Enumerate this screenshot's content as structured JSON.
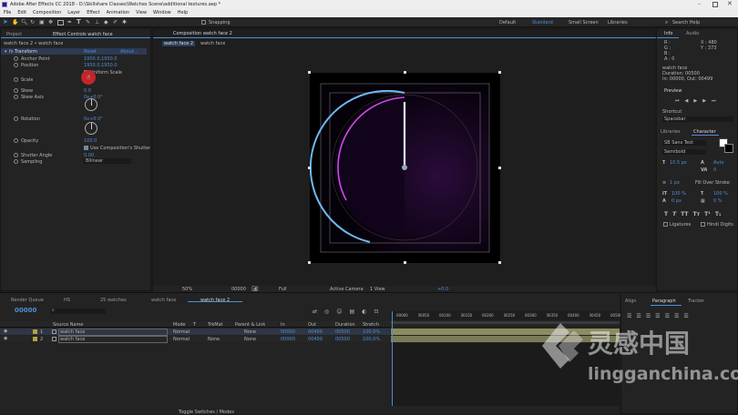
{
  "window": {
    "title": "Adobe After Effects CC 2018 - D:\\Skillshare Classes\\Watches Scene\\additional textures.aep *"
  },
  "menu": [
    "File",
    "Edit",
    "Composition",
    "Layer",
    "Effect",
    "Animation",
    "View",
    "Window",
    "Help"
  ],
  "toolbar": {
    "snapping": "Snapping",
    "workspaces": [
      "Default",
      "Standard",
      "Small Screen",
      "Libraries"
    ],
    "search_placeholder": "Search Help"
  },
  "left_panel": {
    "tab_project": "Project",
    "tab_effects": "Effect Controls watch face",
    "subtitle": "watch face 2 • watch face",
    "transform": "Transform",
    "reset": "Reset",
    "about": "About...",
    "props": [
      {
        "label": "Anchor Point",
        "value": "1950.0,1950.0"
      },
      {
        "label": "Position",
        "value": "1950.0,1950.0"
      },
      {
        "label": "",
        "value": "Uniform Scale"
      },
      {
        "label": "Scale",
        "value": "40.0"
      },
      {
        "label": "Skew",
        "value": "0.0"
      },
      {
        "label": "Skew Axis",
        "value": "0x+0.0°"
      },
      {
        "label": "Rotation",
        "value": "0x+0.0°"
      },
      {
        "label": "Opacity",
        "value": "100.0"
      },
      {
        "label": "",
        "value": "Use Composition's Shutter"
      },
      {
        "label": "Shutter Angle",
        "value": "0.00"
      },
      {
        "label": "Sampling",
        "value": "Bilinear"
      }
    ]
  },
  "comp": {
    "tab": "Composition watch face 2",
    "subtab1": "watch face 2",
    "subtab2": "watch face",
    "footer": {
      "zoom": "50%",
      "time": "00000",
      "quality": "Full",
      "camera": "Active Camera",
      "view": "1 View",
      "exposure": "+0.0"
    }
  },
  "right_panel": {
    "info_tab": "Info",
    "audio_tab": "Audio",
    "info_lines": [
      "R : ",
      "G : ",
      "B : ",
      "A : 0"
    ],
    "xy": [
      "X : 480",
      "Y : 373"
    ],
    "info_name": "watch face",
    "info_duration": "Duration: 00500",
    "info_in_out": "In: 00000, Out: 00499",
    "preview_tab": "Preview",
    "shortcut_label": "Shortcut",
    "shortcut_value": "Spacebar",
    "libraries_tab": "Libraries",
    "character_tab": "Character",
    "font": "SB Sans Text",
    "font_style": "Semibold",
    "size": "10.5 px",
    "leading": "Auto",
    "tracking": "0",
    "stroke_size": "1 px",
    "stroke_mode": "Fill Over Stroke",
    "vscale": "100 %",
    "hscale": "100 %",
    "baseline": "0 px",
    "tsume": "0 %",
    "ligatures": "Ligatures",
    "hindi": "Hindi Digits"
  },
  "timeline": {
    "tabs": [
      "Render Queue",
      "HS",
      "25 watches",
      "watch face",
      "watch face 2"
    ],
    "timecode": "00000",
    "search_placeholder": "",
    "columns": [
      "Source Name",
      "Mode",
      "T",
      "TrkMat",
      "Parent & Link",
      "In",
      "Out",
      "Duration",
      "Stretch"
    ],
    "layers": [
      {
        "num": "1",
        "name": "watch face",
        "mode": "Normal",
        "trkmat": "",
        "parent": "None",
        "in": "00000",
        "out": "00499",
        "dur": "00500",
        "stretch": "100.0%"
      },
      {
        "num": "2",
        "name": "watch face",
        "mode": "Normal",
        "trkmat": "None",
        "parent": "None",
        "in": "00000",
        "out": "00499",
        "dur": "00500",
        "stretch": "100.0%"
      }
    ],
    "ruler": [
      "00000",
      "00050",
      "00100",
      "00150",
      "00200",
      "00250",
      "00300",
      "00350",
      "00400",
      "00450",
      "00500"
    ],
    "toggle": "Toggle Switches / Modes"
  },
  "bottom_right": {
    "tabs": [
      "Align",
      "Paragraph",
      "Tracker"
    ]
  },
  "watermark": {
    "name": "灵感中国",
    "url": "lingganchina.com"
  },
  "colors": {
    "accent": "#2d8ceb",
    "bg": "#232323",
    "watch_magenta": "#c040e0",
    "watch_blue": "#70b8f0"
  }
}
